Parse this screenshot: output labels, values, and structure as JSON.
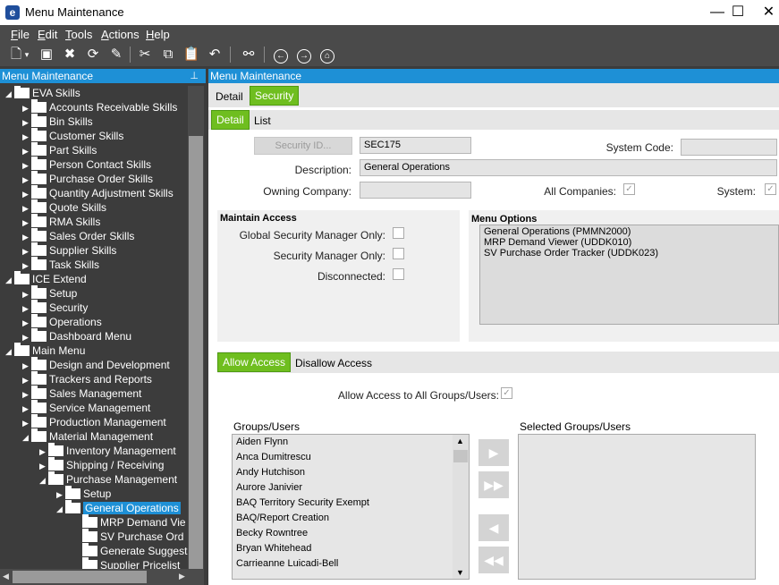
{
  "window": {
    "title": "Menu Maintenance",
    "icon_letter": "e",
    "minimize": "—",
    "maximize": "☐",
    "close": "✕"
  },
  "menubar": [
    "File",
    "Edit",
    "Tools",
    "Actions",
    "Help"
  ],
  "tree": {
    "header": "Menu Maintenance",
    "pin": "📌",
    "nodes": [
      {
        "label": "EVA Skills",
        "expanded": true
      },
      {
        "label": "Accounts Receivable Skills"
      },
      {
        "label": "Bin Skills"
      },
      {
        "label": "Customer Skills"
      },
      {
        "label": "Part Skills"
      },
      {
        "label": "Person Contact Skills"
      },
      {
        "label": "Purchase Order Skills"
      },
      {
        "label": "Quantity Adjustment Skills"
      },
      {
        "label": "Quote Skills"
      },
      {
        "label": "RMA Skills"
      },
      {
        "label": "Sales Order Skills"
      },
      {
        "label": "Supplier Skills"
      },
      {
        "label": "Task Skills"
      },
      {
        "label": "ICE Extend",
        "expanded": true
      },
      {
        "label": "Setup"
      },
      {
        "label": "Security"
      },
      {
        "label": "Operations"
      },
      {
        "label": "Dashboard Menu"
      },
      {
        "label": "Main Menu",
        "expanded": true
      },
      {
        "label": "Design and Development"
      },
      {
        "label": "Trackers and Reports"
      },
      {
        "label": "Sales Management"
      },
      {
        "label": "Service Management"
      },
      {
        "label": "Production Management"
      },
      {
        "label": "Material Management",
        "expanded": true
      },
      {
        "label": "Inventory Management"
      },
      {
        "label": "Shipping / Receiving"
      },
      {
        "label": "Purchase Management",
        "expanded": true
      },
      {
        "label": "Setup"
      },
      {
        "label": "General Operations",
        "expanded": true,
        "selected": true
      },
      {
        "label": "MRP Demand Vie"
      },
      {
        "label": "SV Purchase Ord"
      },
      {
        "label": "Generate Suggest"
      },
      {
        "label": "Supplier Pricelist"
      }
    ]
  },
  "panel": {
    "header": "Menu Maintenance",
    "tabs_top": [
      "Detail",
      "Security"
    ],
    "tabs_sub": [
      "Detail",
      "List"
    ],
    "security_id_button": "Security ID...",
    "security_id_value": "SEC175",
    "system_code_label": "System Code:",
    "system_code_value": "",
    "description_label": "Description:",
    "description_value": "General Operations",
    "owning_company_label": "Owning Company:",
    "owning_company_value": "",
    "all_companies_label": "All Companies:",
    "all_companies_checked": true,
    "system_label": "System:",
    "system_checked": true
  },
  "maintain_access": {
    "title": "Maintain Access",
    "global_security_label": "Global Security Manager Only:",
    "security_manager_label": "Security Manager Only:",
    "disconnected_label": "Disconnected:"
  },
  "menu_options": {
    "title": "Menu Options",
    "items": [
      "General Operations (PMMN2000)",
      "MRP Demand Viewer (UDDK010)",
      "SV Purchase Order Tracker (UDDK023)"
    ]
  },
  "access": {
    "tabs": [
      "Allow Access",
      "Disallow Access"
    ],
    "allow_all_label": "Allow Access to All Groups/Users:",
    "allow_all_checked": true,
    "groups_label": "Groups/Users",
    "selected_label": "Selected Groups/Users",
    "groups": [
      "Aiden Flynn",
      "Anca Dumitrescu",
      "Andy Hutchison",
      "Aurore Janivier",
      "BAQ Territory Security Exempt",
      "BAQ/Report Creation",
      "Becky Rowntree",
      "Bryan Whitehead",
      "Carrieanne Luicadi-Bell"
    ],
    "selected": []
  }
}
